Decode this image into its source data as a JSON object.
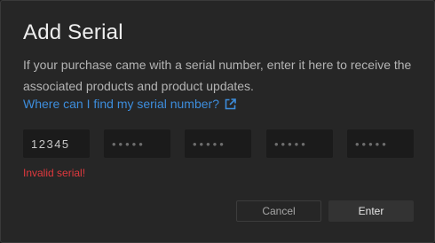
{
  "dialog": {
    "title": "Add Serial",
    "description": "If your purchase came with a serial number, enter it here to receive the associated products and product updates.",
    "help_link": {
      "label": "Where can I find my serial number?",
      "icon": "external-link-icon"
    }
  },
  "serial": {
    "fields": [
      {
        "value": "12345",
        "placeholder": "•••••"
      },
      {
        "value": "",
        "placeholder": "•••••"
      },
      {
        "value": "",
        "placeholder": "•••••"
      },
      {
        "value": "",
        "placeholder": "•••••"
      },
      {
        "value": "",
        "placeholder": "•••••"
      }
    ],
    "error": "Invalid serial!"
  },
  "buttons": {
    "cancel_label": "Cancel",
    "enter_label": "Enter"
  },
  "colors": {
    "accent_link": "#3d8ddc",
    "error": "#e0393e",
    "background": "#262626"
  }
}
